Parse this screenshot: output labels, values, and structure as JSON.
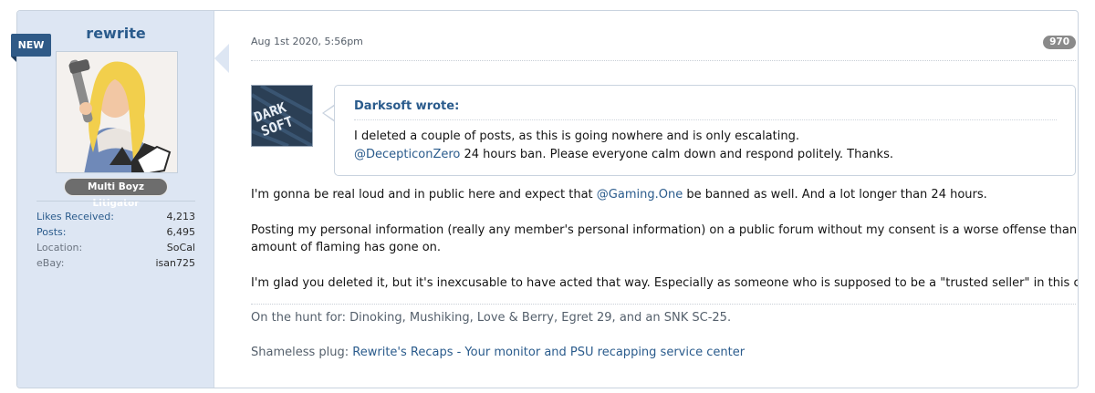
{
  "badge": {
    "new": "NEW"
  },
  "user": {
    "name": "rewrite",
    "title": "Multi Boyz Litigator",
    "stats": [
      {
        "label": "Likes Received:",
        "value": "4,213",
        "link": true
      },
      {
        "label": "Posts:",
        "value": "6,495",
        "link": true
      },
      {
        "label": "Location:",
        "value": "SoCal",
        "link": false
      },
      {
        "label": "eBay:",
        "value": "isan725",
        "link": false
      }
    ]
  },
  "post": {
    "timestamp": "Aug 1st 2020, 5:56pm",
    "number": "970",
    "quote": {
      "author": "Darksoft wrote:",
      "line1": "I deleted a couple of posts, as this is going nowhere and is only escalating.",
      "line2_mention": "@DecepticonZero",
      "line2_rest": " 24 hours ban. Please everyone calm down and respond politely. Thanks."
    },
    "p1_a": "I'm gonna be real loud and in public here and expect that ",
    "p1_mention": "@Gaming.One",
    "p1_b": " be banned as well. And a lot longer than 24 hours.",
    "p2_line1": "Posting my personal information (really any member's personal information) on a public forum without my consent is a worse offense than whatever",
    "p2_line2": "amount of flaming has gone on.",
    "p3": "I'm glad you deleted it, but it's inexcusable to have acted that way. Especially as someone who is supposed to be a \"trusted seller\" in this community."
  },
  "signature": {
    "line1": "On the hunt for: Dinoking, Mushiking, Love & Berry, Egret 29, and an SNK SC-25.",
    "plug_label": "Shameless plug: ",
    "plug_link": "Rewrite's Recaps - Your monitor and PSU recapping service center"
  },
  "colors": {
    "link": "#2a5b8c",
    "sidebar_bg": "#dde6f3",
    "ribbon": "#2f5a87",
    "post_number_badge": "#8a8a8a"
  }
}
